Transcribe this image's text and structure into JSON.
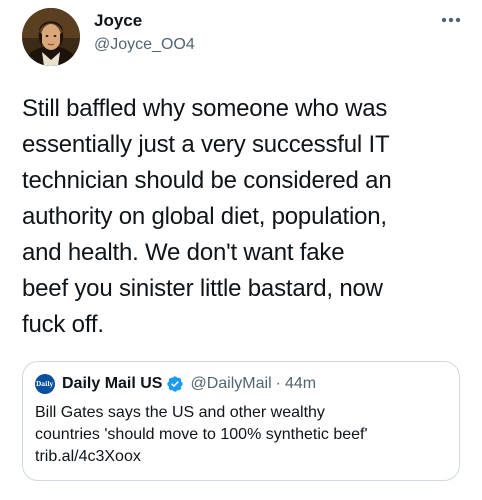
{
  "tweet": {
    "author": {
      "display_name": "Joyce",
      "handle": "@Joyce_OO4",
      "avatar_icon": "portrait-avatar"
    },
    "more_icon": "more-horizontal-icon",
    "text": "Still baffled why someone who was\nessentially just a very successful IT\ntechnician should be considered an\nauthority on global diet, population,\nand health. We don't want fake\nbeef you sinister little bastard, now\nfuck off.",
    "quoted": {
      "avatar_label": "Daily Mail",
      "display_name": "Daily Mail US",
      "verified": true,
      "handle": "@DailyMail",
      "separator": "·",
      "time": "44m",
      "text": "Bill Gates says the US and other wealthy\ncountries 'should move to 100% synthetic beef'\ntrib.al/4c3Xoox"
    }
  },
  "colors": {
    "text_primary": "#0f1419",
    "text_secondary": "#536471",
    "verified_blue": "#1d9bf0",
    "border": "#cfd9de"
  }
}
